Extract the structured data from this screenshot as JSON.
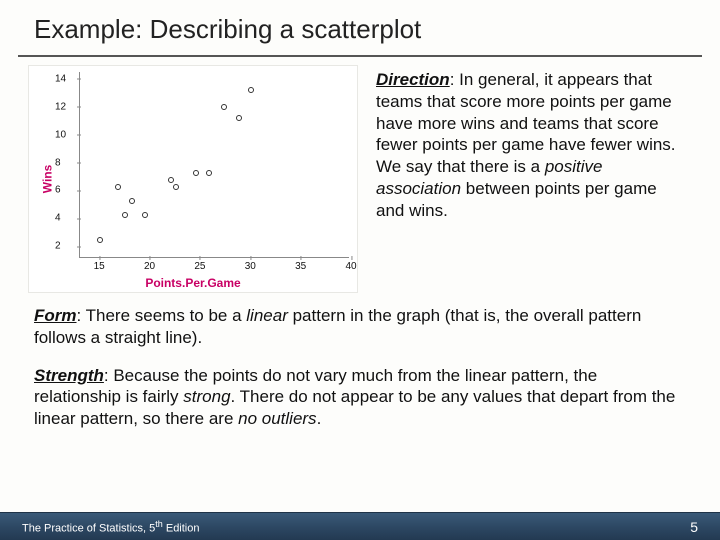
{
  "title": "Example: Describing a scatterplot",
  "direction": {
    "label": "Direction",
    "before_assoc": ": In general, it appears that teams that score more points per game have more wins and teams that score fewer points per game have fewer wins. We say that there is a ",
    "assoc": "positive association",
    "after_assoc": " between points per game and wins."
  },
  "form": {
    "label": "Form",
    "before_linear": ": There seems to be a ",
    "linear": "linear",
    "after_linear": " pattern in the graph (that is, the overall pattern follows a straight line)."
  },
  "strength": {
    "label": "Strength",
    "part1": ": Because the points do not vary much from the linear pattern, the relationship is fairly ",
    "strong": "strong",
    "part2": ".  There do not appear to be any values that depart from the linear pattern, so there are ",
    "outliers": "no outliers",
    "part3": "."
  },
  "chart_data": {
    "type": "scatter",
    "xlabel": "Points.Per.Game",
    "ylabel": "Wins",
    "xlim": [
      13,
      40
    ],
    "ylim": [
      1,
      14.5
    ],
    "xticks": [
      15,
      20,
      25,
      30,
      35,
      40
    ],
    "yticks": [
      2,
      4,
      6,
      8,
      10,
      12,
      14
    ],
    "points": [
      {
        "x": 15.0,
        "y": 2.2
      },
      {
        "x": 16.8,
        "y": 6.0
      },
      {
        "x": 17.5,
        "y": 4.0
      },
      {
        "x": 18.2,
        "y": 5.0
      },
      {
        "x": 19.5,
        "y": 4.0
      },
      {
        "x": 22.0,
        "y": 6.5
      },
      {
        "x": 22.5,
        "y": 6.0
      },
      {
        "x": 24.5,
        "y": 7.0
      },
      {
        "x": 25.8,
        "y": 7.0
      },
      {
        "x": 27.3,
        "y": 11.8
      },
      {
        "x": 28.8,
        "y": 11.0
      },
      {
        "x": 30.0,
        "y": 13.0
      }
    ]
  },
  "footer": {
    "book": "The Practice of Statistics, 5",
    "ed": "th",
    "ed2": " Edition",
    "page": "5"
  }
}
